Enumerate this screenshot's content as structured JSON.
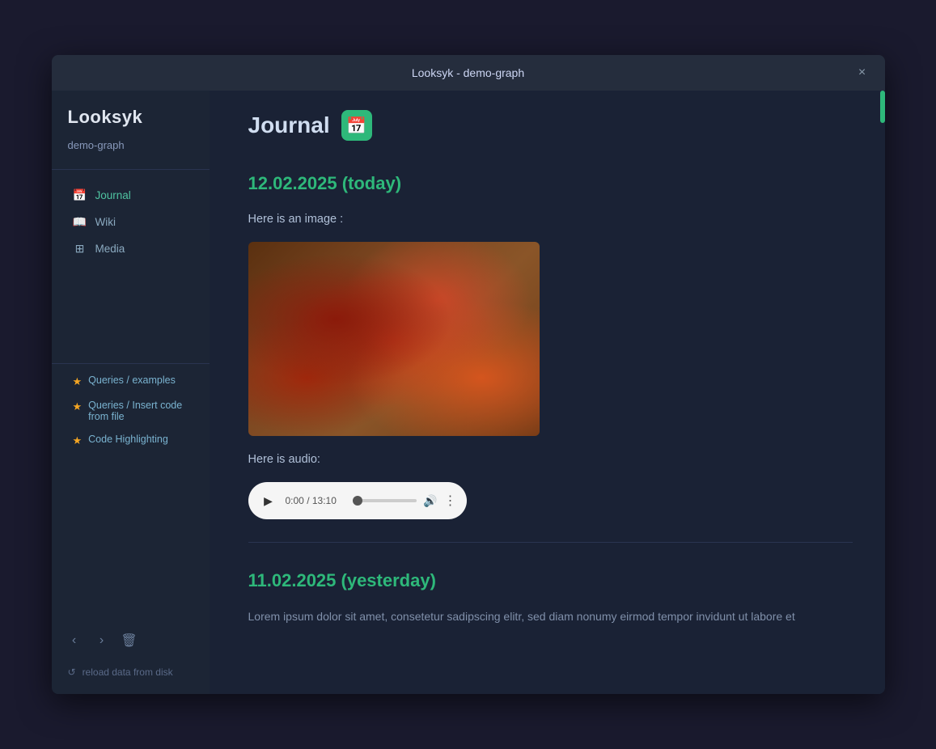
{
  "window": {
    "title": "Looksyk - demo-graph",
    "close_label": "×"
  },
  "sidebar": {
    "logo": "Looksyk",
    "workspace": "demo-graph",
    "collapse_icon": "«",
    "nav_items": [
      {
        "id": "journal",
        "label": "Journal",
        "icon": "📅",
        "active": true
      },
      {
        "id": "wiki",
        "label": "Wiki",
        "icon": "📖",
        "active": false
      },
      {
        "id": "media",
        "label": "Media",
        "icon": "⊞",
        "active": false
      }
    ],
    "starred_items": [
      {
        "id": "queries-examples",
        "label": "Queries / examples"
      },
      {
        "id": "queries-insert",
        "label": "Queries / Insert code from file"
      },
      {
        "id": "code-highlighting",
        "label": "Code Highlighting"
      }
    ],
    "nav_actions": {
      "back_label": "‹",
      "forward_label": "›",
      "delete_label": "🗑"
    },
    "footer": {
      "icon": "↺",
      "label": "reload data from disk"
    }
  },
  "main": {
    "page_title": "Journal",
    "calendar_icon": "📅",
    "entries": [
      {
        "date": "12.02.2025 (today)",
        "blocks": [
          {
            "type": "text",
            "content": "Here is an image :"
          },
          {
            "type": "image",
            "alt": "Pizza photo"
          },
          {
            "type": "text",
            "content": "Here is audio:"
          },
          {
            "type": "audio",
            "time": "0:00",
            "duration": "13:10"
          }
        ]
      },
      {
        "date": "11.02.2025 (yesterday)",
        "blocks": [
          {
            "type": "text",
            "content": "Lorem ipsum dolor sit amet, consetetur sadipscing elitr, sed diam nonumy eirmod tempor invidunt ut labore et"
          }
        ]
      }
    ]
  }
}
